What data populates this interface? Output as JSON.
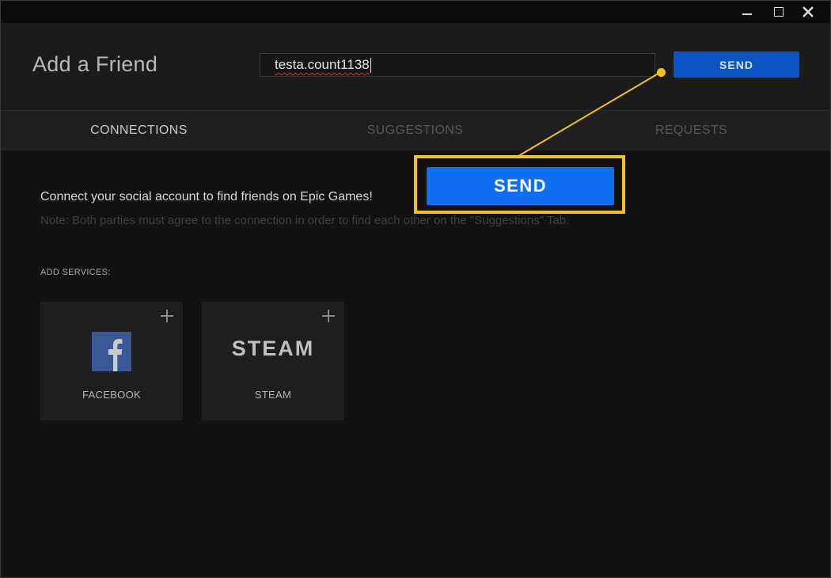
{
  "window": {
    "title": "Add a Friend",
    "controls": [
      "minimize-icon",
      "maximize-icon",
      "close-icon"
    ]
  },
  "search": {
    "value": "testa.count1138"
  },
  "header": {
    "send_label": "SEND"
  },
  "tabs": [
    {
      "label": "CONNECTIONS",
      "active": true
    },
    {
      "label": "SUGGESTIONS",
      "active": false
    },
    {
      "label": "REQUESTS",
      "active": false
    }
  ],
  "connections": {
    "intro": "Connect your social account to find friends on Epic Games!",
    "note": "Note: Both parties must agree to the connection in order to find each other on the \"Suggestions\" Tab.",
    "add_services_label": "ADD SERVICES:",
    "services": [
      {
        "label": "FACEBOOK",
        "icon": "facebook-icon",
        "logo_color": "#3a5796"
      },
      {
        "label": "STEAM",
        "logo_text": "STEAM",
        "icon": "steam-logo"
      }
    ]
  },
  "callout": {
    "send_label": "SEND",
    "highlight_color": "#f4c21b"
  },
  "colors": {
    "accent": "#0f6ff0",
    "send_button": "#0a55c3"
  }
}
